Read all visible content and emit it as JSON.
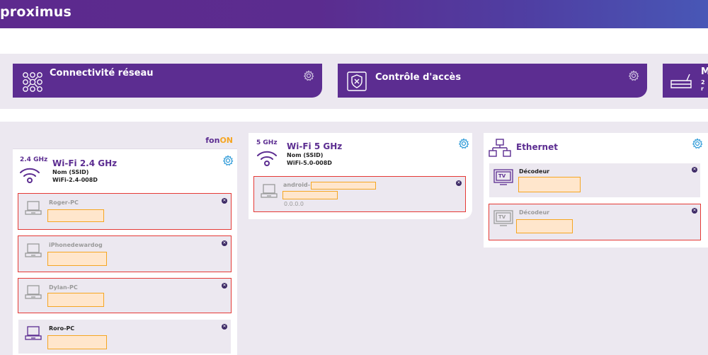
{
  "header": {
    "logo": "proximus"
  },
  "tiles": [
    {
      "title": "Connectivité réseau",
      "icon": "network-icon"
    },
    {
      "title": "Contrôle d'accès",
      "icon": "shield-icon"
    },
    {
      "title": "M",
      "subtitle": "2 r",
      "icon": "router-icon"
    }
  ],
  "wifi24": {
    "fon_label": "fon",
    "fon_on": "ON",
    "band": "2.4 GHz",
    "title": "Wi-Fi 2.4 GHz",
    "ssid_label": "Nom (SSID)",
    "ssid": "WiFi-2.4-008D",
    "devices": [
      {
        "name": "Roger-PC"
      },
      {
        "name": "iPhonedewardog"
      },
      {
        "name": "Dylan-PC"
      },
      {
        "name": "Roro-PC"
      }
    ]
  },
  "wifi5": {
    "band": "5 GHz",
    "title": "Wi-Fi 5 GHz",
    "ssid_label": "Nom (SSID)",
    "ssid": "WiFi-5.0-008D",
    "devices": [
      {
        "name": "android-",
        "ip": "0.0.0.0"
      }
    ]
  },
  "ethernet": {
    "title": "Ethernet",
    "devices": [
      {
        "name": "Décodeur",
        "icon_text": "TV"
      },
      {
        "name": "Décodeur",
        "icon_text": "TV"
      }
    ]
  }
}
